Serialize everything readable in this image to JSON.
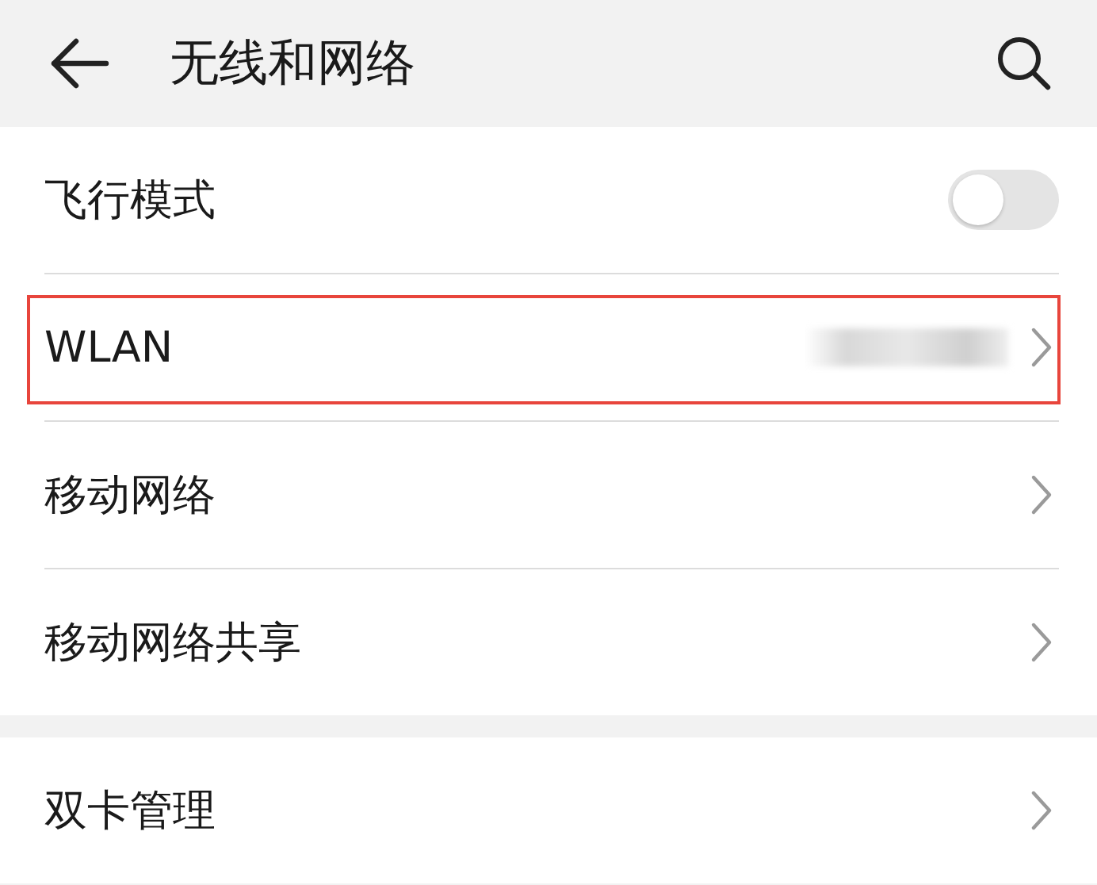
{
  "header": {
    "title": "无线和网络"
  },
  "sections": [
    {
      "rows": [
        {
          "kind": "toggle",
          "label": "飞行模式",
          "on": false,
          "highlighted": false
        },
        {
          "kind": "link",
          "label": "WLAN",
          "redacted_value": true,
          "highlighted": true
        },
        {
          "kind": "link",
          "label": "移动网络",
          "highlighted": false
        },
        {
          "kind": "link",
          "label": "移动网络共享",
          "highlighted": false
        }
      ]
    },
    {
      "rows": [
        {
          "kind": "link",
          "label": "双卡管理",
          "highlighted": false
        }
      ]
    }
  ]
}
